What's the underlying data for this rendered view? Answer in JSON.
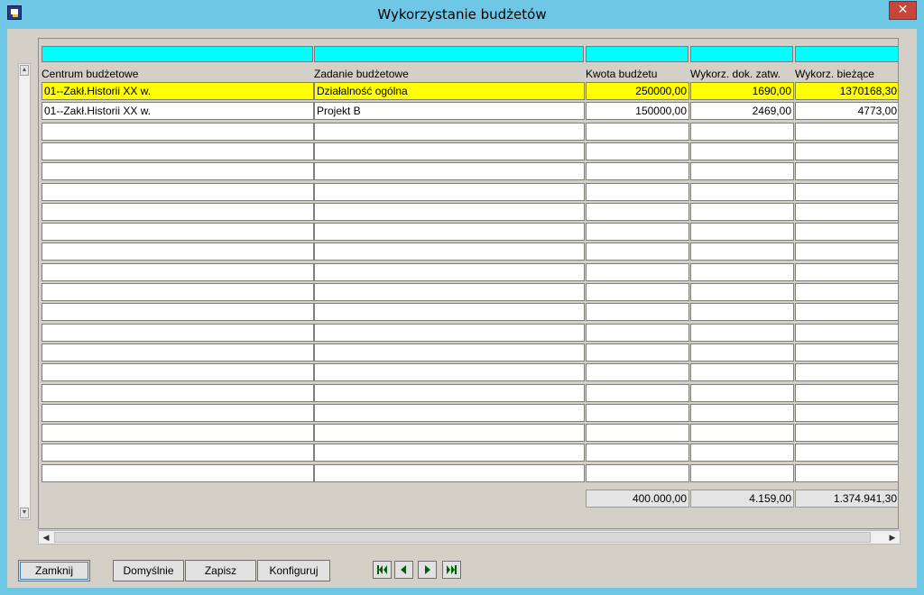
{
  "window": {
    "title": "Wykorzystanie budżetów",
    "close_label": "✕",
    "app_icon": "app-icon",
    "chrome_color": "#6fc7e6"
  },
  "grid": {
    "columns": [
      "Centrum budżetowe",
      "Zadanie budżetowe",
      "Kwota budżetu",
      "Wykorz. dok. zatw.",
      "Wykorz. bieżące"
    ],
    "rows": [
      [
        "01--Zakł.Historii XX w.",
        "Działalność ogólna",
        "250000,00",
        "1690,00",
        "1370168,30"
      ],
      [
        "01--Zakł.Historii XX w.",
        "Projekt B",
        "150000,00",
        "2469,00",
        "4773,00"
      ]
    ],
    "empty_row_count": 18,
    "selected_row": 0,
    "selected_color": "#ffff00",
    "filter_row_color": "#00ffff",
    "totals": [
      "400.000,00",
      "4.159,00",
      "1.374.941,30"
    ]
  },
  "buttons": {
    "close": "Zamknij",
    "defaults": "Domyślnie",
    "save": "Zapisz",
    "configure": "Konfiguruj"
  },
  "navigation": [
    "first-record-icon",
    "previous-record-icon",
    "next-record-icon",
    "last-record-icon"
  ]
}
